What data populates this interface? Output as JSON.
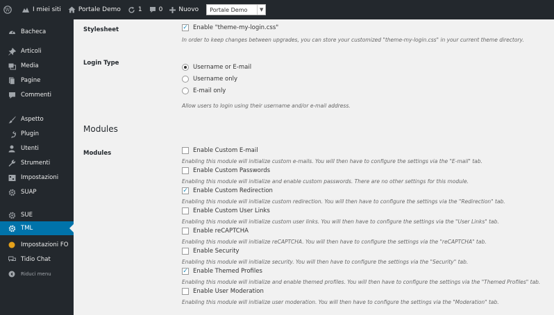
{
  "adminbar": {
    "site_label": "I miei siti",
    "site_name": "Portale Demo",
    "updates_count": "1",
    "comments_count": "0",
    "new_label": "Nuovo",
    "site_select_value": "Portale Demo"
  },
  "sidebar": {
    "items": [
      {
        "label": "Bacheca",
        "icon": "dashboard-icon"
      },
      {
        "label": "Articoli",
        "icon": "pin-icon"
      },
      {
        "label": "Media",
        "icon": "media-icon"
      },
      {
        "label": "Pagine",
        "icon": "page-icon"
      },
      {
        "label": "Commenti",
        "icon": "comment-icon"
      },
      {
        "label": "Aspetto",
        "icon": "brush-icon"
      },
      {
        "label": "Plugin",
        "icon": "plugin-icon"
      },
      {
        "label": "Utenti",
        "icon": "user-icon"
      },
      {
        "label": "Strumenti",
        "icon": "wrench-icon"
      },
      {
        "label": "Impostazioni",
        "icon": "settings-icon"
      },
      {
        "label": "SUAP",
        "icon": "gear-icon"
      },
      {
        "label": "SUE",
        "icon": "gear-icon"
      },
      {
        "label": "TML",
        "icon": "gear-icon",
        "active": true
      },
      {
        "label": "Impostazioni FO",
        "icon": "circle-icon"
      },
      {
        "label": "Tidio Chat",
        "icon": "chat-icon"
      },
      {
        "label": "Riduci menu",
        "icon": "collapse-icon"
      }
    ],
    "accent": "#0073aa"
  },
  "main": {
    "stylesheet": {
      "label": "Stylesheet",
      "checkbox_label": "Enable \"theme-my-login.css\"",
      "checked": true,
      "description": "In order to keep changes between upgrades, you can store your customized \"theme-my-login.css\" in your current theme directory."
    },
    "login_type": {
      "label": "Login Type",
      "options": [
        {
          "label": "Username or E-mail",
          "checked": true
        },
        {
          "label": "Username only",
          "checked": false
        },
        {
          "label": "E-mail only",
          "checked": false
        }
      ],
      "description": "Allow users to login using their username and/or e-mail address."
    },
    "modules_heading": "Modules",
    "modules": {
      "label": "Modules",
      "items": [
        {
          "label": "Enable Custom E-mail",
          "checked": false,
          "description": "Enabling this module will initialize custom e-mails. You will then have to configure the settings via the \"E-mail\" tab."
        },
        {
          "label": "Enable Custom Passwords",
          "checked": false,
          "description": "Enabling this module will initialize and enable custom passwords. There are no other settings for this module."
        },
        {
          "label": "Enable Custom Redirection",
          "checked": true,
          "description": "Enabling this module will initialize custom redirection. You will then have to configure the settings via the \"Redirection\" tab."
        },
        {
          "label": "Enable Custom User Links",
          "checked": false,
          "description": "Enabling this module will initialize custom user links. You will then have to configure the settings via the \"User Links\" tab."
        },
        {
          "label": "Enable reCAPTCHA",
          "checked": false,
          "description": "Enabling this module will initialize reCAPTCHA. You will then have to configure the settings via the \"reCAPTCHA\" tab."
        },
        {
          "label": "Enable Security",
          "checked": false,
          "description": "Enabling this module will initialize security. You will then have to configure the settings via the \"Security\" tab."
        },
        {
          "label": "Enable Themed Profiles",
          "checked": true,
          "description": "Enabling this module will initialize and enable themed profiles. You will then have to configure the settings via the \"Themed Profiles\" tab."
        },
        {
          "label": "Enable User Moderation",
          "checked": false,
          "description": "Enabling this module will initialize user moderation. You will then have to configure the settings via the \"Moderation\" tab."
        }
      ]
    }
  }
}
